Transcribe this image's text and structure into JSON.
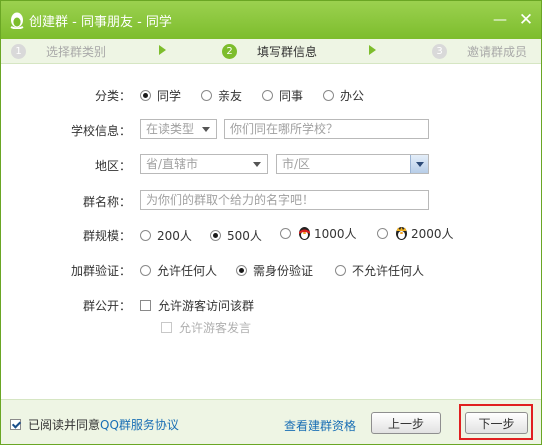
{
  "window": {
    "title": "创建群 - 同事朋友 - 同学",
    "min_glyph": "—",
    "close_glyph": "✕"
  },
  "steps": [
    {
      "num": "1",
      "label": "选择群类别",
      "active": false
    },
    {
      "num": "2",
      "label": "填写群信息",
      "active": true
    },
    {
      "num": "3",
      "label": "邀请群成员",
      "active": false
    }
  ],
  "form": {
    "category": {
      "label": "分类：",
      "options": [
        "同学",
        "亲友",
        "同事",
        "办公"
      ],
      "selected": "同学"
    },
    "school": {
      "label": "学校信息：",
      "type_select": "在读类型",
      "school_placeholder": "你们同在哪所学校？"
    },
    "region": {
      "label": "地区：",
      "province_select": "省/直辖市",
      "city_select": "市/区"
    },
    "group_name": {
      "label": "群名称：",
      "placeholder": "为你们的群取个给力的名字吧！"
    },
    "size": {
      "label": "群规模：",
      "options": [
        "200人",
        "500人",
        "1000人",
        "2000人"
      ],
      "selected": "500人"
    },
    "join_verify": {
      "label": "加群验证：",
      "options": [
        "允许任何人",
        "需身份验证",
        "不允许任何人"
      ],
      "selected": "需身份验证"
    },
    "public": {
      "label": "群公开：",
      "allow_visitors": "允许游客访问该群",
      "allow_visitors_checked": false,
      "allow_visitors_post": "允许游客发言",
      "allow_visitors_post_enabled": false
    }
  },
  "footer": {
    "agree_text": "已阅读并同意",
    "agree_link": "QQ群服务协议",
    "agree_checked": true,
    "qualification_link": "查看建群资格",
    "prev_button": "上一步",
    "next_button": "下一步"
  },
  "colors": {
    "titlebar": "#7dbd2d",
    "link": "#1a6fb5",
    "highlight": "#e02020"
  }
}
